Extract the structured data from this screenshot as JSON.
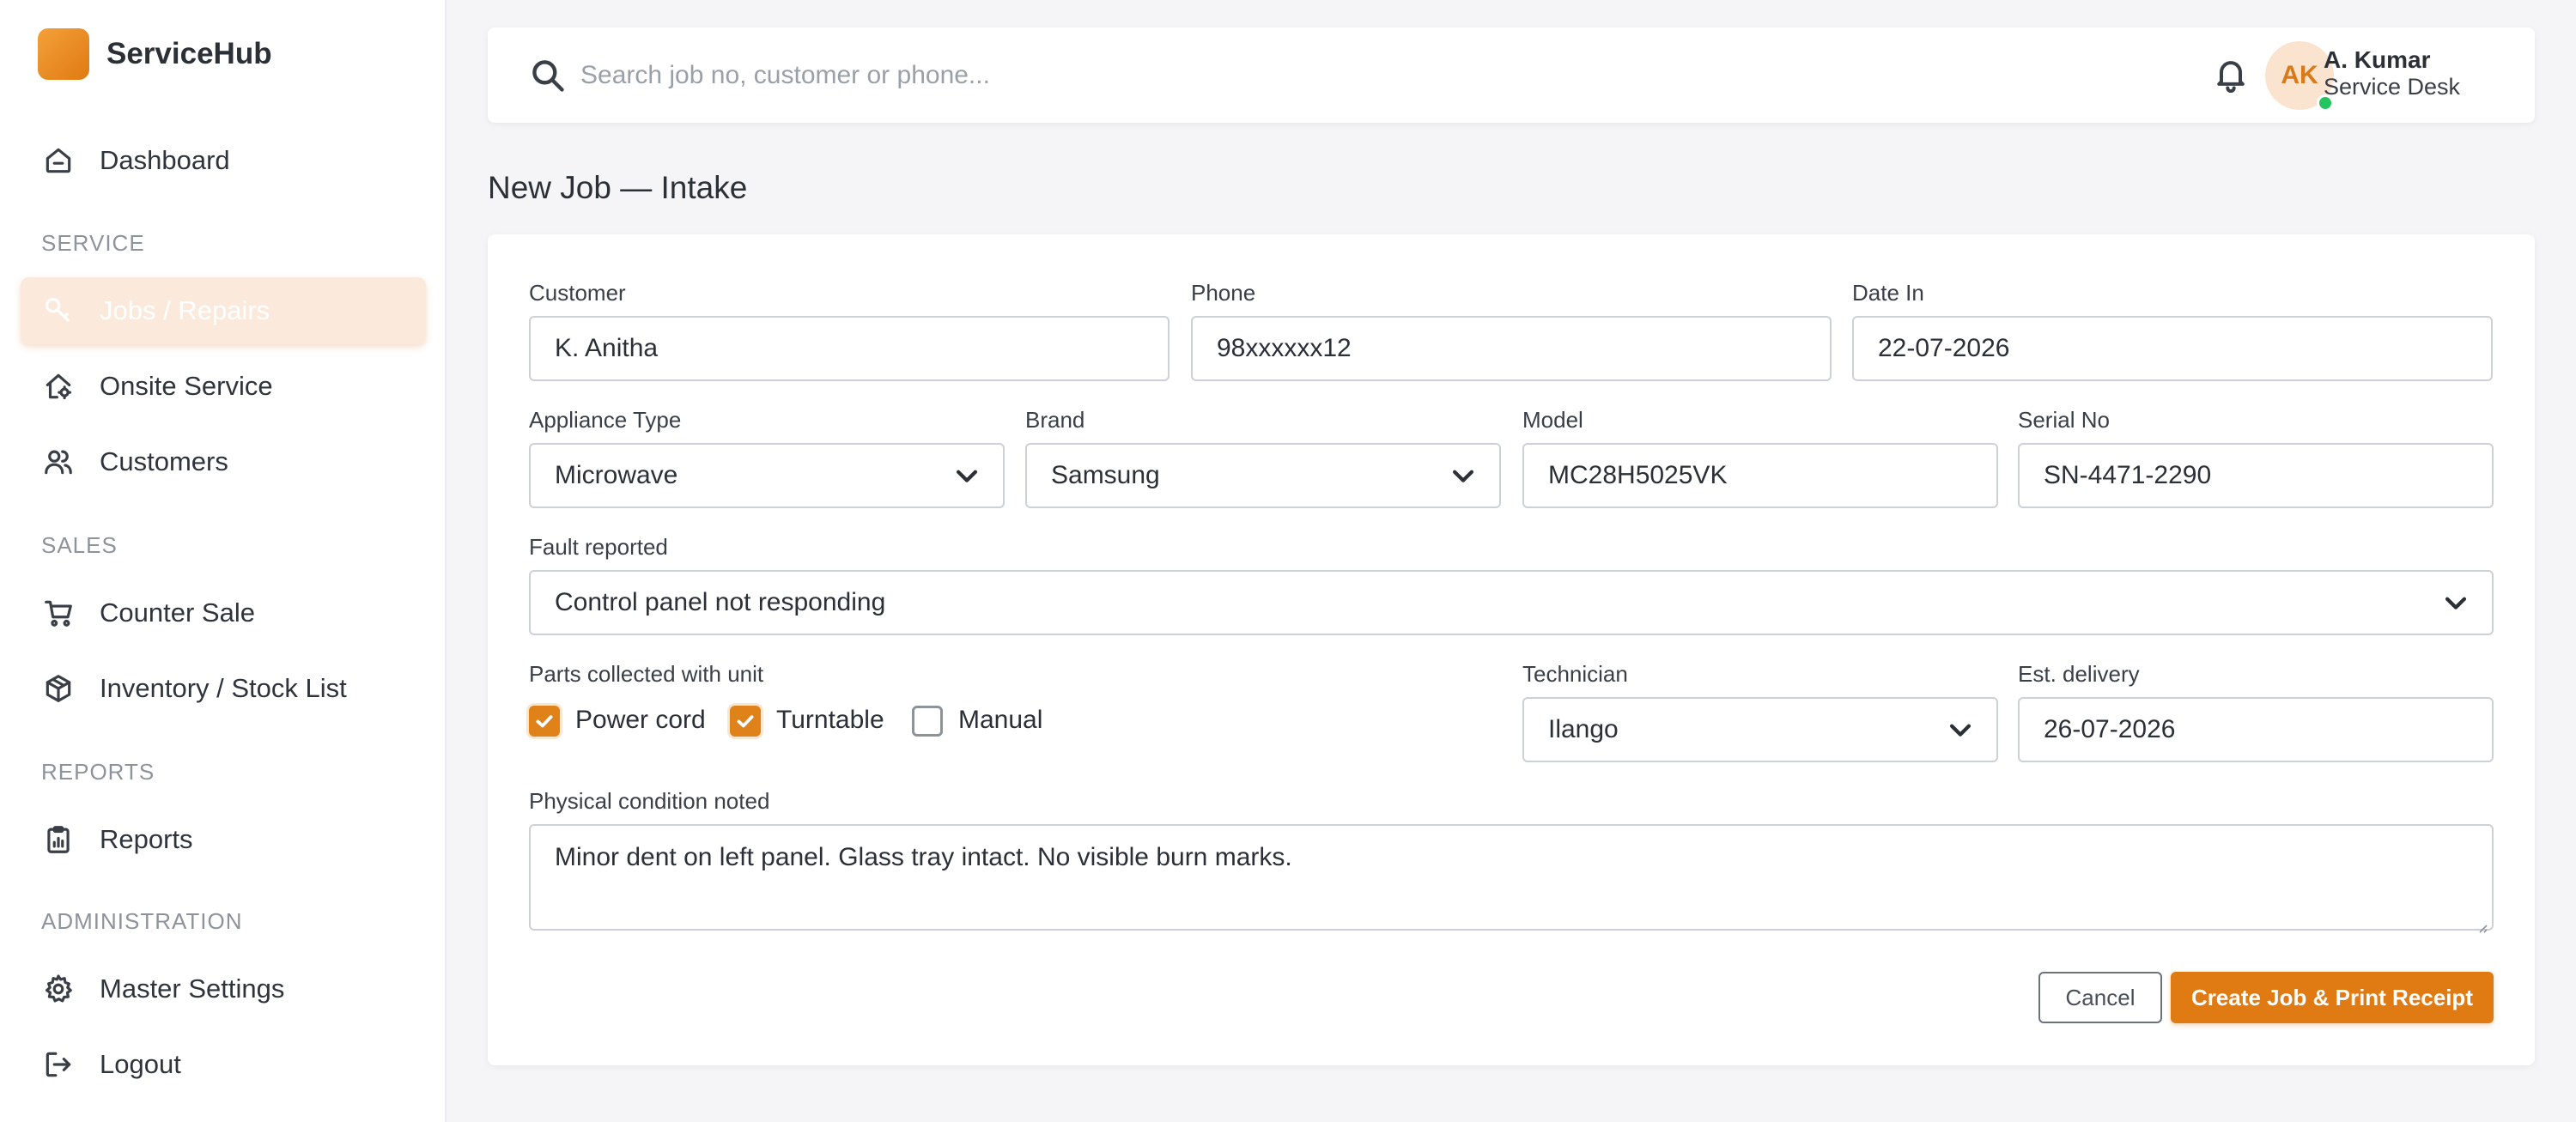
{
  "brand": {
    "name": "ServiceHub"
  },
  "sidebar": {
    "dashboard": "Dashboard",
    "sections": {
      "service": "SERVICE",
      "sales": "SALES",
      "reports": "REPORTS",
      "administration": "ADMINISTRATION"
    },
    "items": {
      "jobs": "Jobs / Repairs",
      "onsite": "Onsite Service",
      "customers": "Customers",
      "counter_sale": "Counter Sale",
      "inventory": "Inventory / Stock List",
      "reports": "Reports",
      "master_settings": "Master Settings",
      "logout": "Logout"
    },
    "active_item": "Jobs / Repairs"
  },
  "topbar": {
    "search_placeholder": "Search job no, customer or phone...",
    "user": {
      "initials": "AK",
      "name": "A. Kumar",
      "role": "Service Desk",
      "online": true
    }
  },
  "page": {
    "title": "New Job — Intake"
  },
  "form": {
    "customer": {
      "label": "Customer",
      "value": "K. Anitha"
    },
    "phone": {
      "label": "Phone",
      "value": "98xxxxxx12"
    },
    "date_in": {
      "label": "Date In",
      "value": "22-07-2026"
    },
    "appliance_type": {
      "label": "Appliance Type",
      "value": "Microwave"
    },
    "brand": {
      "label": "Brand",
      "value": "Samsung"
    },
    "model": {
      "label": "Model",
      "value": "MC28H5025VK"
    },
    "serial_no": {
      "label": "Serial No",
      "value": "SN-4471-2290"
    },
    "fault": {
      "label": "Fault reported",
      "value": "Control panel not responding"
    },
    "parts": {
      "label": "Parts collected with unit",
      "items": [
        {
          "label": "Power cord",
          "checked": true
        },
        {
          "label": "Turntable",
          "checked": true
        },
        {
          "label": "Manual",
          "checked": false
        }
      ]
    },
    "technician": {
      "label": "Technician",
      "value": "Ilango"
    },
    "est_delivery": {
      "label": "Est. delivery",
      "value": "26-07-2026"
    },
    "condition": {
      "label": "Physical condition noted",
      "value": "Minor dent on left panel. Glass tray intact. No visible burn marks."
    }
  },
  "actions": {
    "cancel": "Cancel",
    "submit": "Create Job & Print Receipt"
  },
  "colors": {
    "accent": "#e07a12",
    "active_nav_bg": "#fbeadb",
    "online": "#22c55e"
  }
}
